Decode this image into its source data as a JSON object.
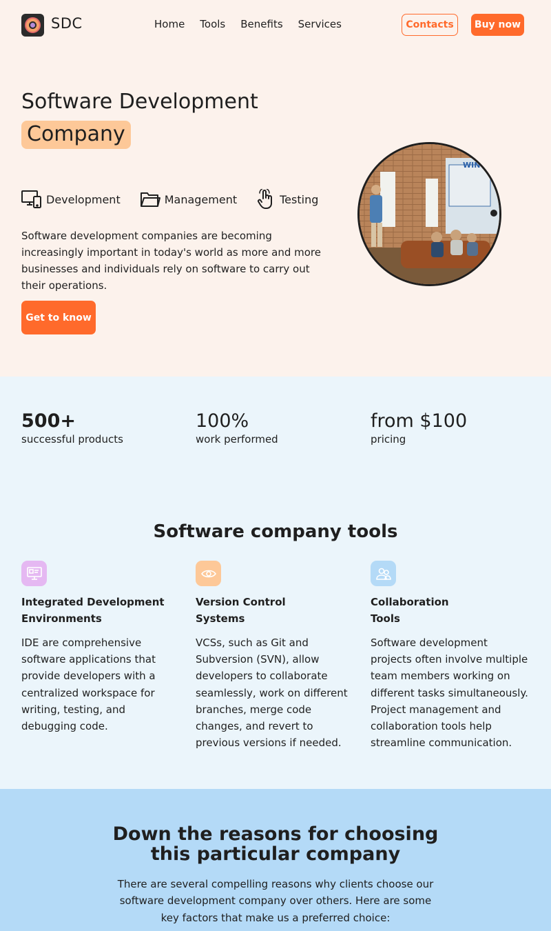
{
  "header": {
    "brand": "SDC",
    "nav": [
      "Home",
      "Tools",
      "Benefits",
      "Services"
    ],
    "contacts_label": "Contacts",
    "buy_label": "Buy now"
  },
  "hero": {
    "title_line1": "Software Development",
    "title_highlight": "Company",
    "features": [
      {
        "label": "Development",
        "icon": "devices-icon"
      },
      {
        "label": "Management",
        "icon": "folder-icon"
      },
      {
        "label": "Testing",
        "icon": "pointer-hand-icon"
      }
    ],
    "description": "Software development companies are becoming increasingly important in today's world as more and more businesses and individuals rely on software to carry out their operations.",
    "cta_label": "Get to know"
  },
  "stats": [
    {
      "value": "500+",
      "label": "successful products"
    },
    {
      "value": "100%",
      "label": "work performed"
    },
    {
      "value": "from $100",
      "label": "pricing"
    }
  ],
  "tools": {
    "heading": "Software company tools",
    "items": [
      {
        "title": "Integrated Development\nEnvironments",
        "text": "IDE are comprehensive software applications that provide developers with a centralized workspace for writing, testing, and debugging code.",
        "icon": "monitor-icon",
        "color": "#e5b8f2"
      },
      {
        "title": "Version Control\nSystems",
        "text": "VCSs, such as Git and Subversion (SVN), allow developers to collaborate seamlessly, work on different branches, merge code changes, and revert to previous versions if needed.",
        "icon": "eye-icon",
        "color": "#fdc898"
      },
      {
        "title": "Collaboration\nTools",
        "text": "Software development projects often involve multiple team members working on different tasks simultaneously. Project management and collaboration tools help streamline communication.",
        "icon": "users-icon",
        "color": "#b4daf7"
      }
    ]
  },
  "reasons": {
    "title_line1": "Down the reasons for choosing",
    "title_line2": "this particular company",
    "text": "There are several compelling reasons why clients choose our software development company over others. Here are some key factors that make us a preferred choice:"
  },
  "colors": {
    "accent": "#ff6a2b",
    "hero_bg": "#fcf2ec",
    "light_band": "#ebf5fb",
    "blue_band": "#b4daf7",
    "highlight": "#fdc898"
  }
}
